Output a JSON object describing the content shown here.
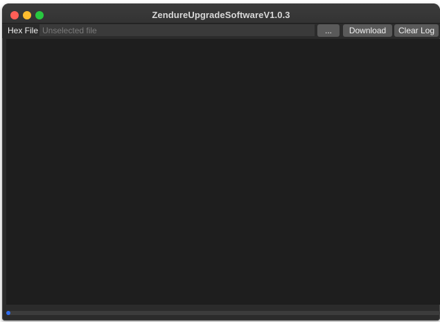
{
  "window": {
    "title": "ZendureUpgradeSoftwareV1.0.3"
  },
  "toolbar": {
    "hex_file_label": "Hex File",
    "file_placeholder": "Unselected file",
    "file_value": "",
    "browse_label": "...",
    "download_label": "Download",
    "clear_log_label": "Clear Log"
  },
  "log": {
    "text": ""
  },
  "progress": {
    "value_percent": 1
  },
  "colors": {
    "close": "#ff5f57",
    "minimize": "#febc2e",
    "zoom": "#28c840",
    "progress_accent": "#2f6df0"
  }
}
